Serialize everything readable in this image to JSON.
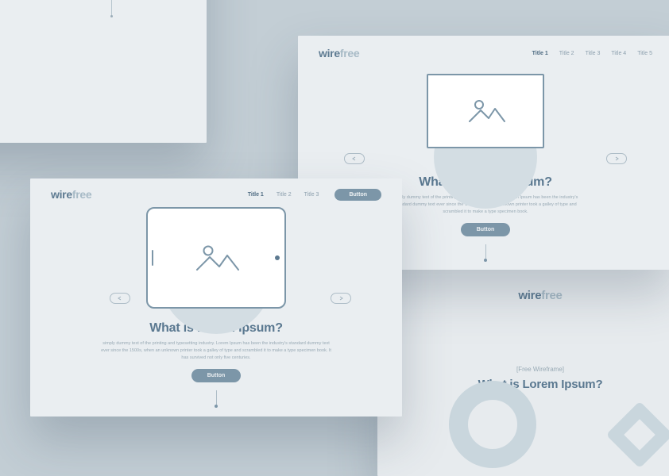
{
  "brand": {
    "part1": "wire",
    "part2": "free"
  },
  "cardB": {
    "nav": [
      "Title 1",
      "Title 2",
      "Title 3",
      "Title 4",
      "Title 5"
    ],
    "active_nav_index": 0,
    "heading": "What is Lorem Ipsum?",
    "subtext": "simply dummy text of the printing and typesetting industry. Lorem Ipsum has been the industry's standard dummy text ever since the 1500s, when an unknown printer took a galley of type and scrambled it to make a type specimen book.",
    "button": "Button"
  },
  "cardA": {
    "nav": [
      "Title 1",
      "Title 2",
      "Title 3"
    ],
    "active_nav_index": 0,
    "cta": "Button",
    "heading": "What is Lorem Ipsum?",
    "subtext": "simply dummy text of the printing and typesetting industry. Lorem Ipsum has been the industry's standard dummy text ever since the 1500s, when an unknown printer took a galley of type and scrambled it to make a type specimen book. It has survived not only five centuries.",
    "button": "Button"
  },
  "cardC": {
    "label": "[Free Wireframe]",
    "heading": "What is Lorem Ipsum?"
  }
}
